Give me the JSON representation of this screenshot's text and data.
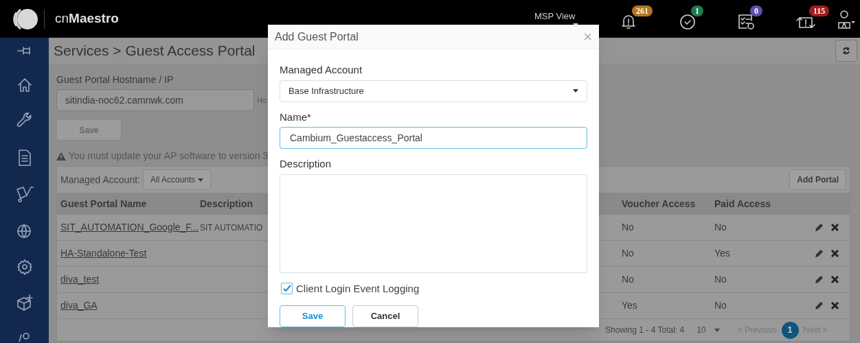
{
  "header": {
    "brand_prefix": "cn",
    "brand_name": "Maestro",
    "view_label": "MSP View",
    "badges": [
      {
        "kind": "alarm",
        "count": "261",
        "color": "#b5761c"
      },
      {
        "kind": "check",
        "count": "1",
        "color": "#1f7a4d"
      },
      {
        "kind": "tasks",
        "count": "0",
        "color": "#5b4fa8"
      },
      {
        "kind": "events",
        "count": "115",
        "color": "#a31c1c"
      }
    ]
  },
  "sidebar": {
    "items": [
      {
        "kind": "pin"
      },
      {
        "kind": "home"
      },
      {
        "kind": "wrench"
      },
      {
        "kind": "document"
      },
      {
        "kind": "cart"
      },
      {
        "kind": "globe"
      },
      {
        "kind": "gear"
      },
      {
        "kind": "box"
      },
      {
        "kind": "person"
      }
    ]
  },
  "page": {
    "title": "Services > Guest Access Portal",
    "hostname_label": "Guest Portal Hostname / IP",
    "hostname_value": "sitindia-noc62.camnwk.com",
    "hint": "Ho",
    "save": "Save",
    "warning": "You must update your AP software to version 3"
  },
  "table": {
    "filter_label": "Managed Account:",
    "filter_value": "All Accounts",
    "add_button": "Add Portal",
    "columns": [
      "Guest Portal Name",
      "Description",
      "Voucher Access",
      "Paid Access"
    ],
    "rows": [
      {
        "name": "SIT_AUTOMATION_Google_F...",
        "description": "SIT AUTOMATIO",
        "voucher": "No",
        "paid": "No"
      },
      {
        "name": "HA-Standalone-Test",
        "description": "",
        "voucher": "No",
        "paid": "Yes"
      },
      {
        "name": "diva_test",
        "description": "",
        "voucher": "No",
        "paid": "No"
      },
      {
        "name": "diva_GA",
        "description": "",
        "voucher": "Yes",
        "paid": "No"
      }
    ],
    "summary": "Showing 1 - 4 Total: 4",
    "page_size": "10",
    "previous": "< Previous",
    "pages": [
      {
        "label": "1",
        "selected": true
      }
    ],
    "next": "Next >"
  },
  "dialog": {
    "title": "Add Guest Portal",
    "close": "×",
    "account_label": "Managed Account",
    "account_value": "Base Infrastructure",
    "name_label": "Name*",
    "name_value": "Cambium_Guestaccess_Portal",
    "description_label": "Description",
    "logging": {
      "label": "Client Login Event Logging",
      "checked": true
    },
    "save": "Save",
    "cancel": "Cancel"
  }
}
